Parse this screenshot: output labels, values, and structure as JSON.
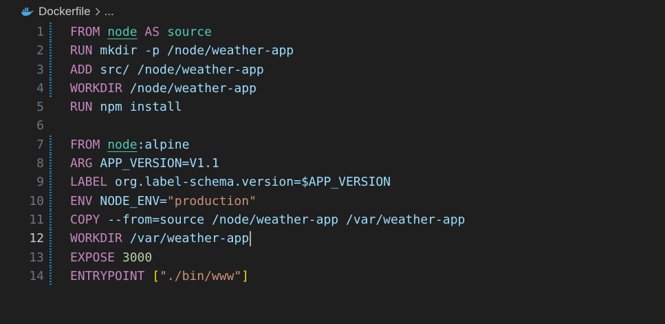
{
  "breadcrumb": {
    "file_icon": "docker-whale-icon",
    "file_name": "Dockerfile",
    "separator": ">",
    "more": "..."
  },
  "editor": {
    "current_line": 12,
    "lines": [
      {
        "num": "1",
        "tokens": [
          {
            "t": "FROM",
            "c": "kw"
          },
          {
            "t": " ",
            "c": "plain"
          },
          {
            "t": "node",
            "c": "img"
          },
          {
            "t": " ",
            "c": "plain"
          },
          {
            "t": "AS",
            "c": "kw"
          },
          {
            "t": " ",
            "c": "plain"
          },
          {
            "t": "source",
            "c": "tag"
          }
        ],
        "mark": "modified"
      },
      {
        "num": "2",
        "tokens": [
          {
            "t": "RUN",
            "c": "kw"
          },
          {
            "t": " mkdir -p /node/weather-app",
            "c": "plain"
          }
        ],
        "mark": "modified"
      },
      {
        "num": "3",
        "tokens": [
          {
            "t": "ADD",
            "c": "kw"
          },
          {
            "t": " src/ /node/weather-app",
            "c": "plain"
          }
        ],
        "mark": "modified"
      },
      {
        "num": "4",
        "tokens": [
          {
            "t": "WORKDIR",
            "c": "kw"
          },
          {
            "t": " /node/weather-app",
            "c": "plain"
          }
        ],
        "mark": "modified"
      },
      {
        "num": "5",
        "tokens": [
          {
            "t": "RUN",
            "c": "kw"
          },
          {
            "t": " npm install",
            "c": "plain"
          }
        ],
        "mark": ""
      },
      {
        "num": "6",
        "tokens": [],
        "mark": ""
      },
      {
        "num": "7",
        "tokens": [
          {
            "t": "FROM",
            "c": "kw"
          },
          {
            "t": " ",
            "c": "plain"
          },
          {
            "t": "node",
            "c": "img"
          },
          {
            "t": ":alpine",
            "c": "plain"
          }
        ],
        "mark": "modified"
      },
      {
        "num": "8",
        "tokens": [
          {
            "t": "ARG",
            "c": "kw"
          },
          {
            "t": " APP_VERSION=V1.1",
            "c": "plain"
          }
        ],
        "mark": "modified"
      },
      {
        "num": "9",
        "tokens": [
          {
            "t": "LABEL",
            "c": "kw"
          },
          {
            "t": " org.label-schema.version=$APP_VERSION",
            "c": "plain"
          }
        ],
        "mark": "modified"
      },
      {
        "num": "10",
        "tokens": [
          {
            "t": "ENV",
            "c": "kw"
          },
          {
            "t": " NODE_ENV=",
            "c": "plain"
          },
          {
            "t": "\"production\"",
            "c": "str"
          }
        ],
        "mark": "modified"
      },
      {
        "num": "11",
        "tokens": [
          {
            "t": "COPY",
            "c": "kw"
          },
          {
            "t": " --from=source /node/weather-app /var/weather-app",
            "c": "plain"
          }
        ],
        "mark": "modified"
      },
      {
        "num": "12",
        "tokens": [
          {
            "t": "WORKDIR",
            "c": "kw"
          },
          {
            "t": " /var/weather-app",
            "c": "plain"
          }
        ],
        "mark": "modified",
        "cursor": true
      },
      {
        "num": "13",
        "tokens": [
          {
            "t": "EXPOSE",
            "c": "kw"
          },
          {
            "t": " ",
            "c": "plain"
          },
          {
            "t": "3000",
            "c": "num"
          }
        ],
        "mark": "modified"
      },
      {
        "num": "14",
        "tokens": [
          {
            "t": "ENTRYPOINT",
            "c": "kw"
          },
          {
            "t": " ",
            "c": "plain"
          },
          {
            "t": "[",
            "c": "br"
          },
          {
            "t": "\"./bin/www\"",
            "c": "str"
          },
          {
            "t": "]",
            "c": "br"
          }
        ],
        "mark": "modified"
      }
    ]
  },
  "colors": {
    "background": "#1f1f1f",
    "keyword": "#c586c0",
    "identifier": "#9cdcfe",
    "image": "#4ec9b0",
    "string": "#ce9178",
    "number": "#b5cea8",
    "bracket": "#ffd700",
    "gutter_modified": "#1b81a8"
  }
}
